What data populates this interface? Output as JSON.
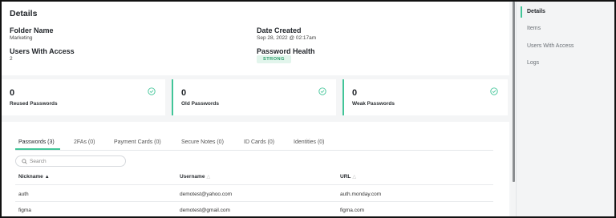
{
  "details": {
    "title": "Details",
    "folder_name_label": "Folder Name",
    "folder_name_value": "Marketing",
    "date_created_label": "Date Created",
    "date_created_value": "Sep 28, 2022 @ 02:17am",
    "users_access_label": "Users With Access",
    "users_access_value": "2",
    "password_health_label": "Password Health",
    "password_health_value": "STRONG"
  },
  "stats": [
    {
      "value": "0",
      "label": "Reused Passwords"
    },
    {
      "value": "0",
      "label": "Old Passwords"
    },
    {
      "value": "0",
      "label": "Weak Passwords"
    }
  ],
  "tabs": [
    {
      "label": "Passwords (3)"
    },
    {
      "label": "2FAs (0)"
    },
    {
      "label": "Payment Cards (0)"
    },
    {
      "label": "Secure Notes (0)"
    },
    {
      "label": "ID Cards (0)"
    },
    {
      "label": "Identities (0)"
    }
  ],
  "search": {
    "placeholder": "Search"
  },
  "table": {
    "columns": [
      "Nickname",
      "Username",
      "URL"
    ],
    "rows": [
      {
        "nickname": "auth",
        "username": "demotest@yahoo.com",
        "url": "auth.monday.com"
      },
      {
        "nickname": "figma",
        "username": "demotest@gmail.com",
        "url": "figma.com"
      }
    ]
  },
  "sidebar": {
    "items": [
      {
        "label": "Details"
      },
      {
        "label": "Items"
      },
      {
        "label": "Users With Access"
      },
      {
        "label": "Logs"
      }
    ]
  },
  "colors": {
    "accent": "#41c598",
    "badge_bg": "#e2f5ec"
  }
}
